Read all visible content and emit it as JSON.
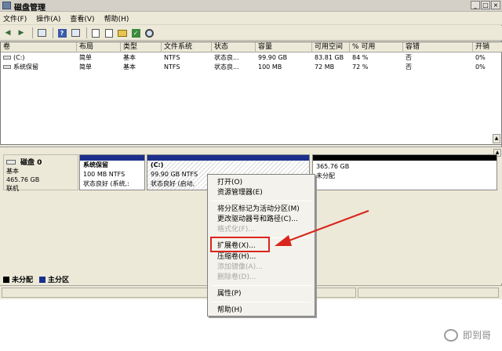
{
  "window": {
    "title": "磁盘管理",
    "controls": [
      "_",
      "□",
      "×"
    ]
  },
  "menubar": {
    "items": [
      "文件(F)",
      "操作(A)",
      "查看(V)",
      "帮助(H)"
    ]
  },
  "toolbar": {
    "icons": [
      "back-arrow-icon",
      "forward-arrow-icon",
      "console-tree-icon",
      "help-icon",
      "properties-icon",
      "refresh-icon",
      "export-icon",
      "folder-icon",
      "check-icon",
      "magnifier-icon"
    ]
  },
  "volume_table": {
    "headers": [
      "卷",
      "布局",
      "类型",
      "文件系统",
      "状态",
      "容量",
      "可用空间",
      "% 可用",
      "容错",
      "开销"
    ],
    "rows": [
      [
        "(C:)",
        "简单",
        "基本",
        "NTFS",
        "状态良...",
        "99.90 GB",
        "83.81 GB",
        "84 %",
        "否",
        "0%"
      ],
      [
        "系统保留",
        "简单",
        "基本",
        "NTFS",
        "状态良...",
        "100 MB",
        "72 MB",
        "72 %",
        "否",
        "0%"
      ]
    ]
  },
  "disk": {
    "name": "磁盘 0",
    "type": "基本",
    "size": "465.76 GB",
    "status": "联机"
  },
  "partitions": [
    {
      "title": "系统保留",
      "line1": "100 MB NTFS",
      "line2": "状态良好 (系统,:",
      "bar_color": "#1c2f8c"
    },
    {
      "title": "(C:)",
      "line1": "99.90 GB NTFS",
      "line2": "状态良好 (启动,",
      "bar_color": "#1c2f8c"
    },
    {
      "title": "",
      "line1": "365.76 GB",
      "line2": "未分配",
      "bar_color": "#000000"
    }
  ],
  "legend": [
    {
      "label": "未分配",
      "color": "#000000"
    },
    {
      "label": "主分区",
      "color": "#1c2f8c"
    }
  ],
  "context_menu": {
    "items": [
      {
        "label": "打开(O)",
        "enabled": true
      },
      {
        "label": "资源管理器(E)",
        "enabled": true
      },
      {
        "label": "将分区标记为活动分区(M)",
        "enabled": true
      },
      {
        "label": "更改驱动器号和路径(C)...",
        "enabled": true
      },
      {
        "label": "格式化(F)...",
        "enabled": false
      },
      {
        "label": "扩展卷(X)...",
        "enabled": true
      },
      {
        "label": "压缩卷(H)...",
        "enabled": true
      },
      {
        "label": "添加镜像(A)...",
        "enabled": false
      },
      {
        "label": "删除卷(D)...",
        "enabled": false
      },
      {
        "label": "属性(P)",
        "enabled": true
      },
      {
        "label": "帮助(H)",
        "enabled": true
      }
    ]
  },
  "annotation": {
    "highlight_color": "#d9261c"
  },
  "watermark": {
    "text": "即到哥"
  }
}
